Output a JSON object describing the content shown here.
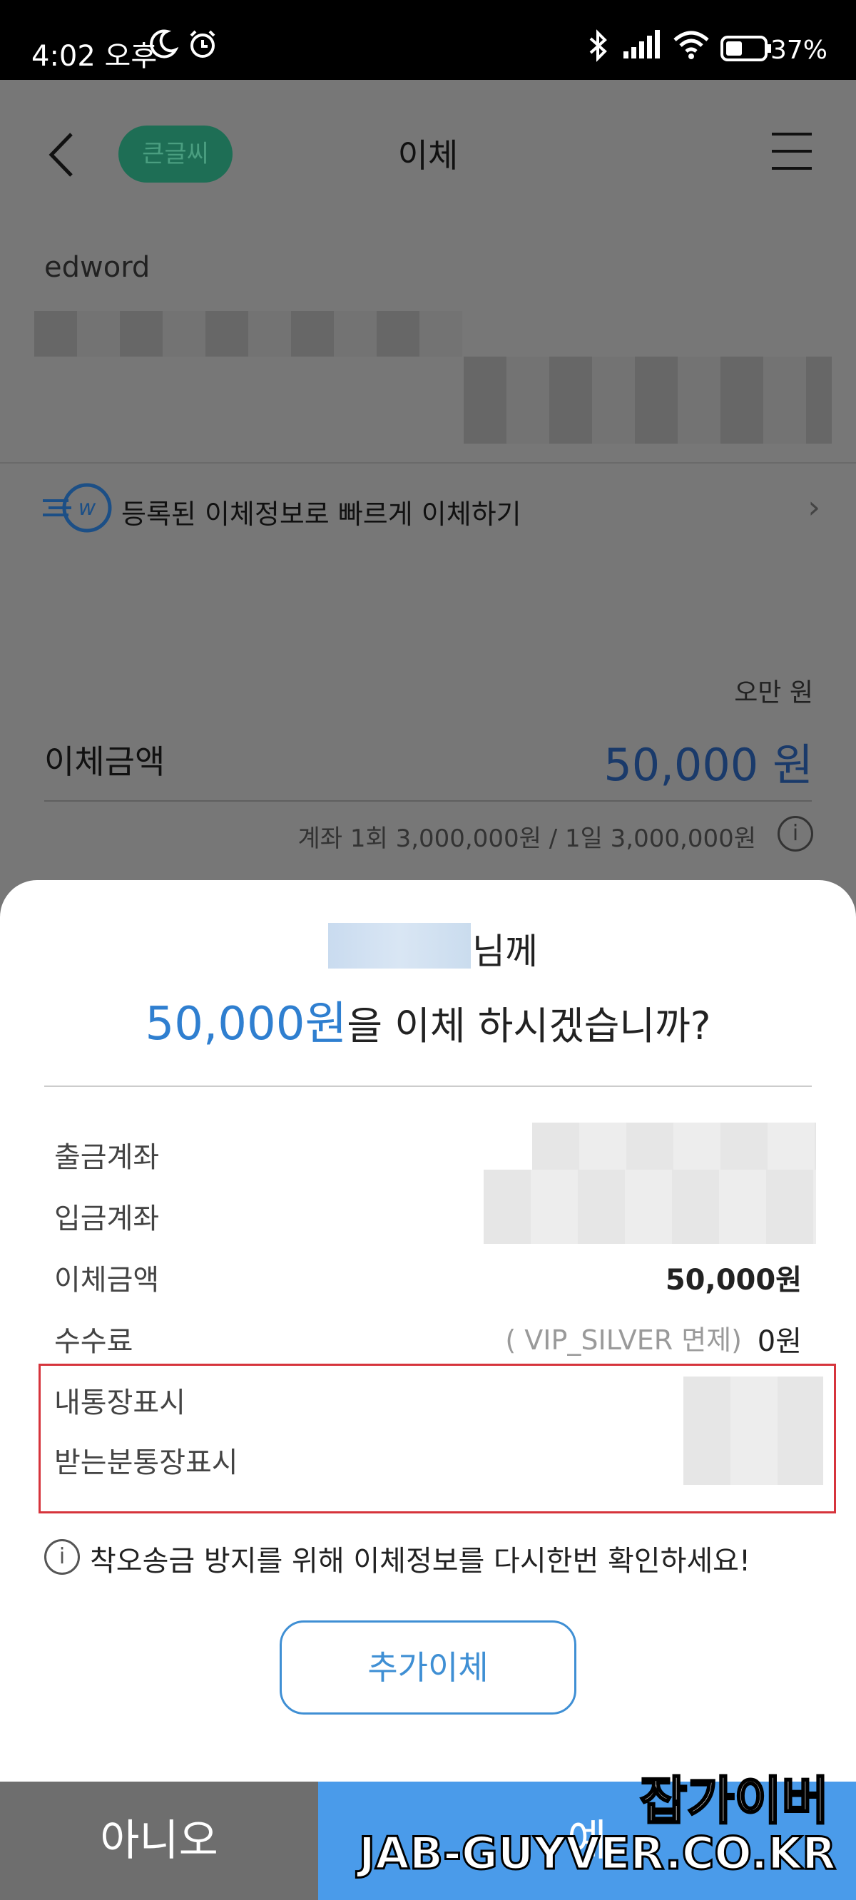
{
  "status_bar": {
    "time": "4:02 오후",
    "battery": "37%"
  },
  "header": {
    "pill": "큰글씨",
    "title": "이체"
  },
  "account": {
    "name": "edword"
  },
  "quick_transfer": {
    "label": "등록된 이체정보로 빠르게 이체하기"
  },
  "transfer": {
    "korean_amount": "오만 원",
    "label": "이체금액",
    "value": "50,000 원",
    "limit": "계좌 1회 3,000,000원 / 1일 3,000,000원"
  },
  "dialog": {
    "recipient_suffix": "님께",
    "amount": "50,000원",
    "question": "을 이체 하시겠습니까?",
    "rows": {
      "from_label": "출금계좌",
      "to_label": "입금계좌",
      "amount_label": "이체금액",
      "amount_value": "50,000원",
      "fee_label": "수수료",
      "fee_note": "( VIP_SILVER 면제)",
      "fee_value": "0원",
      "my_memo_label": "내통장표시",
      "their_memo_label": "받는분통장표시"
    },
    "warning": "착오송금 방지를 위해 이체정보를 다시한번 확인하세요!",
    "add_button": "추가이체",
    "no_button": "아니오",
    "yes_button": "예"
  },
  "watermark": {
    "korean": "잡가이버",
    "english": "JAB-GUYVER.CO.KR"
  }
}
